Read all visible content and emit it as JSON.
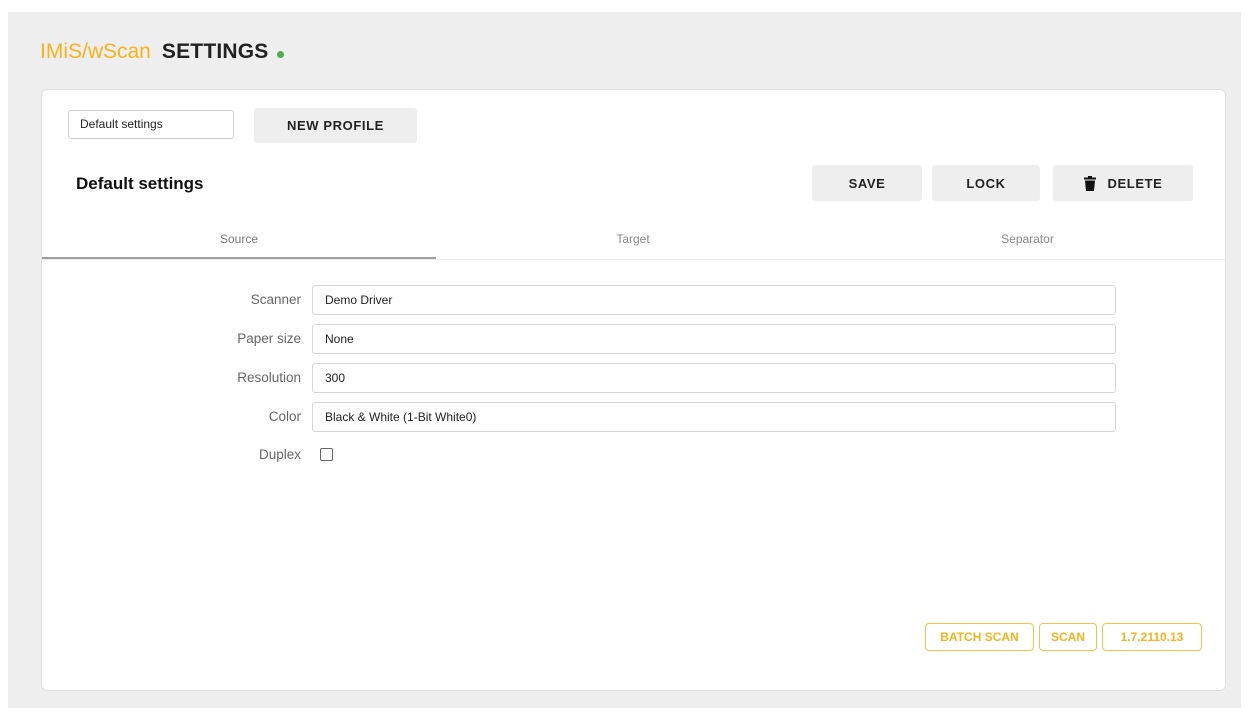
{
  "header": {
    "brand": "IMiS/wScan",
    "title": "SETTINGS",
    "status_color": "#4caf50"
  },
  "toolbar": {
    "profile_select_value": "Default settings",
    "new_profile_label": "NEW PROFILE"
  },
  "profile": {
    "name": "Default settings",
    "save_label": "SAVE",
    "lock_label": "LOCK",
    "delete_label": "DELETE",
    "delete_icon": "trash-icon"
  },
  "tabs": [
    {
      "label": "Source",
      "active": true
    },
    {
      "label": "Target",
      "active": false
    },
    {
      "label": "Separator",
      "active": false
    }
  ],
  "form": {
    "scanner": {
      "label": "Scanner",
      "value": "Demo Driver"
    },
    "paper_size": {
      "label": "Paper size",
      "value": "None"
    },
    "resolution": {
      "label": "Resolution",
      "value": "300"
    },
    "color": {
      "label": "Color",
      "value": "Black & White  (1-Bit White0)"
    },
    "duplex": {
      "label": "Duplex",
      "checked": false
    }
  },
  "footer": {
    "batch_scan_label": "BATCH SCAN",
    "scan_label": "SCAN",
    "version": "1.7.2110.13"
  },
  "colors": {
    "accent": "#f5b31c",
    "button_bg": "#eeeeee",
    "page_bg": "#eeeeee"
  }
}
